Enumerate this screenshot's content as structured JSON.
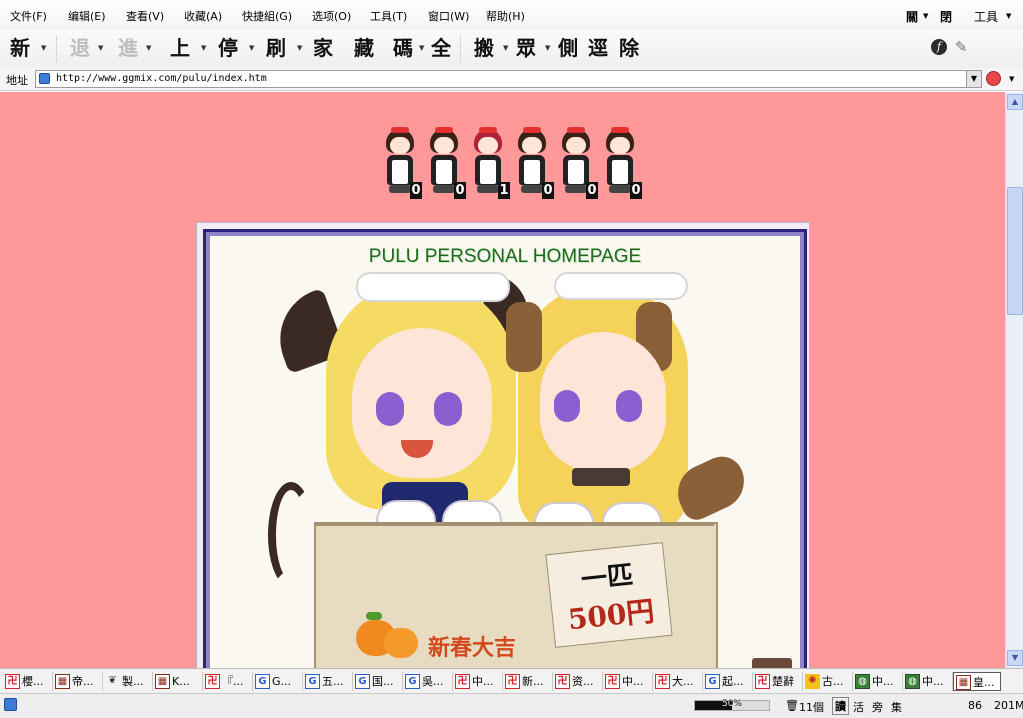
{
  "menubar": {
    "items": [
      "文件(F)",
      "编辑(E)",
      "查看(V)",
      "收藏(A)",
      "快捷組(G)",
      "选项(O)",
      "工具(T)",
      "窗口(W)",
      "帮助(H)"
    ],
    "right_items": [
      "關",
      "閉"
    ],
    "right_tools": "工具"
  },
  "toolbar": {
    "buttons": [
      "新",
      "退",
      "進",
      "上",
      "停",
      "刷",
      "家",
      "藏",
      "碼",
      "全",
      "搬",
      "眾",
      "側",
      "逕",
      "除"
    ]
  },
  "address": {
    "label": "地址",
    "url": "http://www.ggmix.com/pulu/index.htm"
  },
  "counter": {
    "digits": [
      "0",
      "0",
      "1",
      "0",
      "0",
      "0"
    ]
  },
  "banner": {
    "title": "PULU PERSONAL HOMEPAGE",
    "sign_line1": "一匹",
    "sign_line2": "500円",
    "greeting": "新春大吉"
  },
  "tabs": [
    {
      "icon": "ie",
      "label": "櫻..."
    },
    {
      "icon": "page",
      "label": "帝..."
    },
    {
      "icon": "art",
      "label": "製..."
    },
    {
      "icon": "page",
      "label": "K..."
    },
    {
      "icon": "ie",
      "label": "『..."
    },
    {
      "icon": "google",
      "label": "G..."
    },
    {
      "icon": "google",
      "label": "五..."
    },
    {
      "icon": "google",
      "label": "国..."
    },
    {
      "icon": "google",
      "label": "吳..."
    },
    {
      "icon": "ie",
      "label": "中..."
    },
    {
      "icon": "ie",
      "label": "新..."
    },
    {
      "icon": "ie",
      "label": "资..."
    },
    {
      "icon": "ie",
      "label": "中..."
    },
    {
      "icon": "ie",
      "label": "大..."
    },
    {
      "icon": "google",
      "label": "起..."
    },
    {
      "icon": "ie",
      "label": "楚辭"
    },
    {
      "icon": "swirl",
      "label": "古..."
    },
    {
      "icon": "globe",
      "label": "中..."
    },
    {
      "icon": "globe",
      "label": "中..."
    },
    {
      "icon": "page",
      "label": "皇..."
    }
  ],
  "status": {
    "progress": "50%",
    "trash_count": "11個",
    "tools": [
      "讀",
      "活",
      "旁",
      "集"
    ],
    "number": "86",
    "memory": "201M"
  }
}
